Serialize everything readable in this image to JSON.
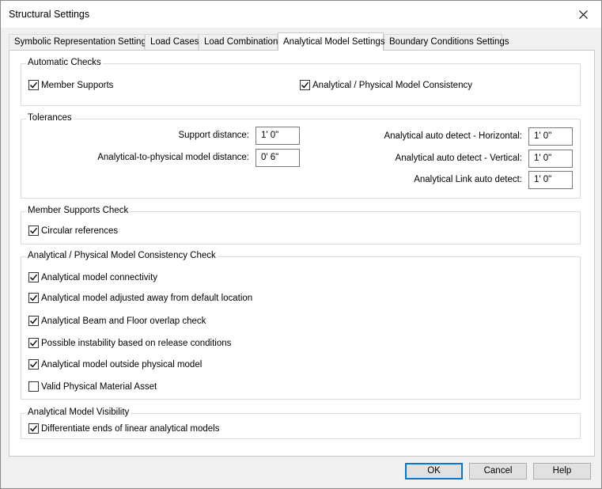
{
  "window": {
    "title": "Structural Settings"
  },
  "tabs": [
    {
      "label": "Symbolic Representation Settings"
    },
    {
      "label": "Load Cases"
    },
    {
      "label": "Load Combinations"
    },
    {
      "label": "Analytical Model Settings",
      "active": true
    },
    {
      "label": "Boundary Conditions Settings"
    }
  ],
  "automatic_checks": {
    "title": "Automatic Checks",
    "member_supports": {
      "label": "Member Supports",
      "checked": true
    },
    "consistency": {
      "label": "Analytical / Physical Model Consistency",
      "checked": true
    }
  },
  "tolerances": {
    "title": "Tolerances",
    "support_distance": {
      "label": "Support distance:",
      "value": "1'  0\""
    },
    "analytical_to_physical": {
      "label": "Analytical-to-physical model distance:",
      "value": "0'  6\""
    },
    "auto_detect_horizontal": {
      "label": "Analytical auto detect - Horizontal:",
      "value": "1'  0\""
    },
    "auto_detect_vertical": {
      "label": "Analytical auto detect - Vertical:",
      "value": "1'  0\""
    },
    "link_auto_detect": {
      "label": "Analytical Link auto detect:",
      "value": "1'  0\""
    }
  },
  "member_supports_check": {
    "title": "Member Supports Check",
    "circular_references": {
      "label": "Circular references",
      "checked": true
    }
  },
  "consistency_check": {
    "title": "Analytical / Physical Model Consistency Check",
    "items": [
      {
        "label": "Analytical model connectivity",
        "checked": true
      },
      {
        "label": "Analytical model adjusted away from default location",
        "checked": true
      },
      {
        "label": "Analytical Beam and Floor overlap check",
        "checked": true
      },
      {
        "label": "Possible instability based on release conditions",
        "checked": true
      },
      {
        "label": "Analytical model outside physical model",
        "checked": true
      },
      {
        "label": "Valid Physical Material Asset",
        "checked": false
      }
    ]
  },
  "visibility": {
    "title": "Analytical Model Visibility",
    "differentiate_ends": {
      "label": "Differentiate ends of linear analytical models",
      "checked": true
    }
  },
  "buttons": {
    "ok": "OK",
    "cancel": "Cancel",
    "help": "Help"
  }
}
